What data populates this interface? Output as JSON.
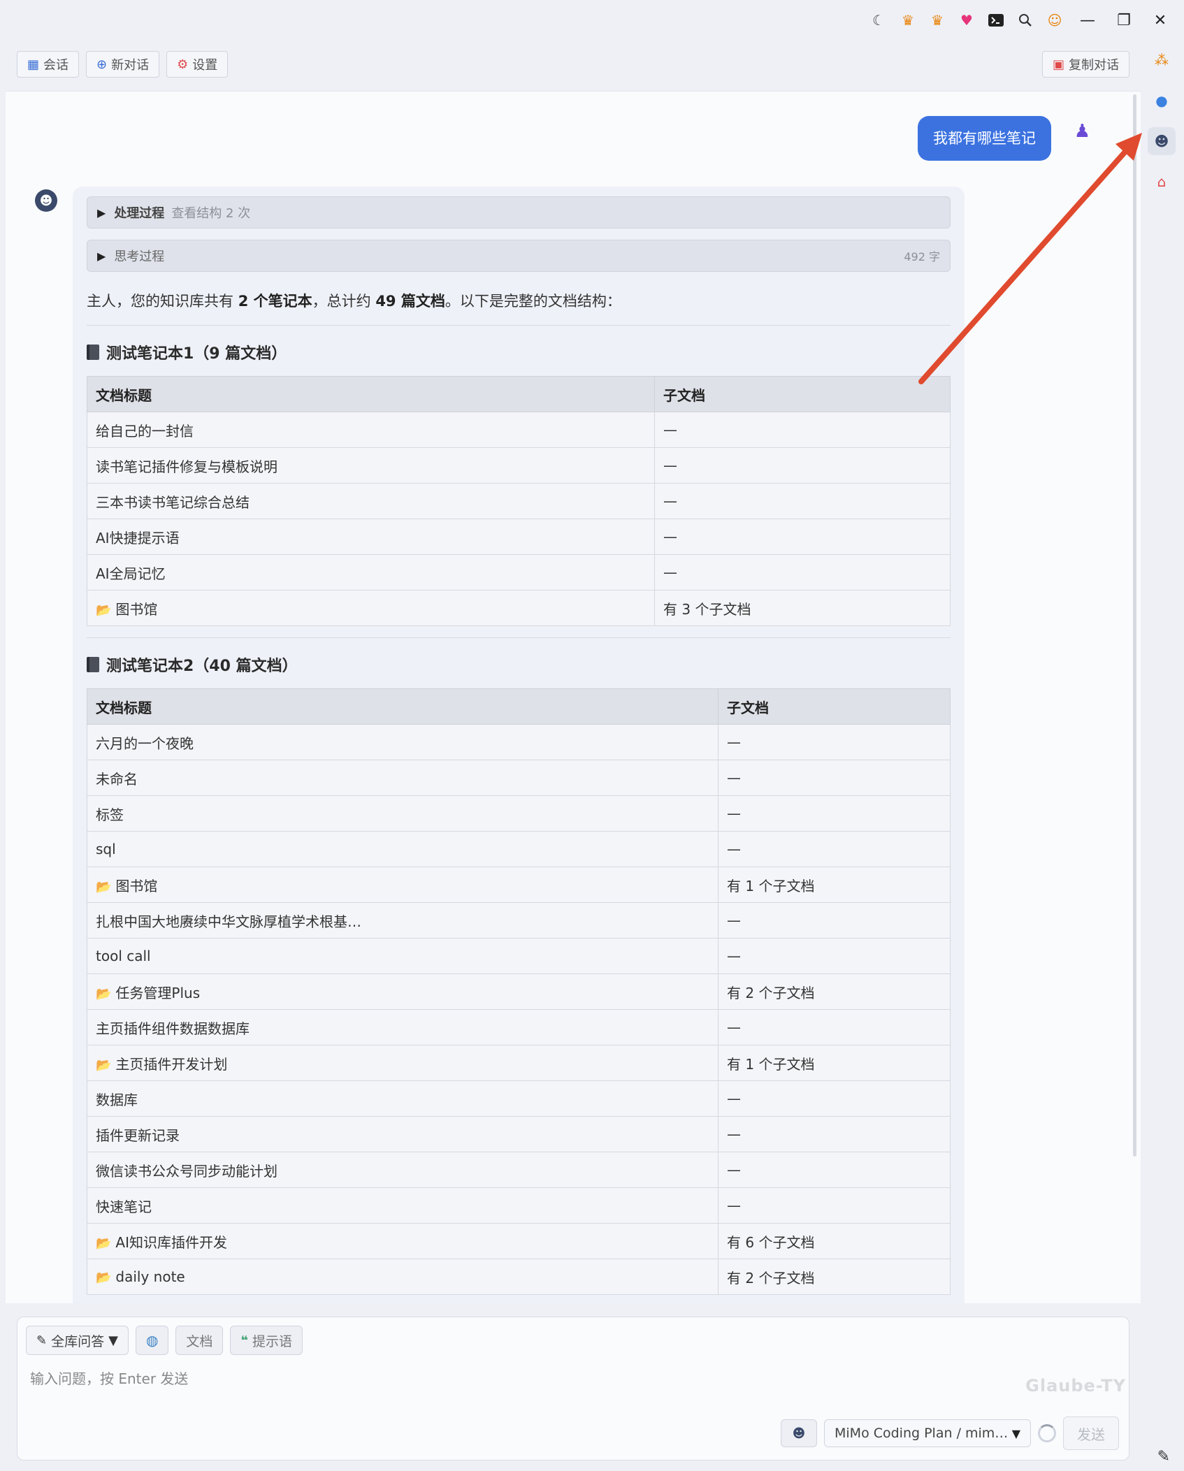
{
  "titlebar": {
    "icons": [
      "moon-icon",
      "crown-icon",
      "crown-icon",
      "heart-icon",
      "terminal-icon",
      "search-icon",
      "emoji-icon"
    ],
    "minimize": "—",
    "restore": "❐",
    "close": "✕"
  },
  "toolbar": {
    "sessions_label": "会话",
    "new_chat_label": "新对话",
    "settings_label": "设置",
    "copy_label": "复制对话"
  },
  "chat": {
    "user_message": "我都有哪些笔记",
    "process_fold": {
      "title": "处理过程",
      "subtitle": "查看结构 2 次"
    },
    "thinking_fold": {
      "title": "思考过程",
      "count": "492 字"
    },
    "intro_parts": {
      "p1": "主人，您的知识库共有 ",
      "b1": "2 个笔记本",
      "p2": "，总计约 ",
      "b2": "49 篇文档",
      "p3": "。以下是完整的文档结构："
    },
    "notebooks": [
      {
        "heading": "测试笔记本1（9 篇文档）",
        "col_title": "文档标题",
        "col_children": "子文档",
        "rows": [
          {
            "title": "给自己的一封信",
            "children": "—",
            "folder": false
          },
          {
            "title": "读书笔记插件修复与模板说明",
            "children": "—",
            "folder": false
          },
          {
            "title": "三本书读书笔记综合总结",
            "children": "—",
            "folder": false
          },
          {
            "title": "AI快捷提示语",
            "children": "—",
            "folder": false
          },
          {
            "title": "AI全局记忆",
            "children": "—",
            "folder": false
          },
          {
            "title": "图书馆",
            "children": "有 3 个子文档",
            "folder": true
          }
        ]
      },
      {
        "heading": "测试笔记本2（40 篇文档）",
        "col_title": "文档标题",
        "col_children": "子文档",
        "rows": [
          {
            "title": "六月的一个夜晚",
            "children": "—",
            "folder": false
          },
          {
            "title": "未命名",
            "children": "—",
            "folder": false
          },
          {
            "title": "标签",
            "children": "—",
            "folder": false
          },
          {
            "title": "sql",
            "children": "—",
            "folder": false
          },
          {
            "title": "图书馆",
            "children": "有 1 个子文档",
            "folder": true
          },
          {
            "title": "扎根中国大地赓续中华文脉厚植学术根基…",
            "children": "—",
            "folder": false
          },
          {
            "title": "tool call",
            "children": "—",
            "folder": false
          },
          {
            "title": "任务管理Plus",
            "children": "有 2 个子文档",
            "folder": true
          },
          {
            "title": "主页插件组件数据数据库",
            "children": "—",
            "folder": false
          },
          {
            "title": "主页插件开发计划",
            "children": "有 1 个子文档",
            "folder": true
          },
          {
            "title": "数据库",
            "children": "—",
            "folder": false
          },
          {
            "title": "插件更新记录",
            "children": "—",
            "folder": false
          },
          {
            "title": "微信读书公众号同步动能计划",
            "children": "—",
            "folder": false
          },
          {
            "title": "快速笔记",
            "children": "—",
            "folder": false
          },
          {
            "title": "AI知识库插件开发",
            "children": "有 6 个子文档",
            "folder": true
          },
          {
            "title": "daily note",
            "children": "有 2 个子文档",
            "folder": true
          }
        ]
      }
    ]
  },
  "input": {
    "mode_label": "全库问答",
    "docs_label": "文档",
    "prompts_label": "提示语",
    "placeholder": "输入问题，按 Enter 发送",
    "watermark": "Glaube-TY",
    "model": "MiMo Coding Plan / mim…",
    "send_label": "发送"
  },
  "colors": {
    "accent": "#3b72e0",
    "annotation_arrow": "#e04a2e"
  }
}
